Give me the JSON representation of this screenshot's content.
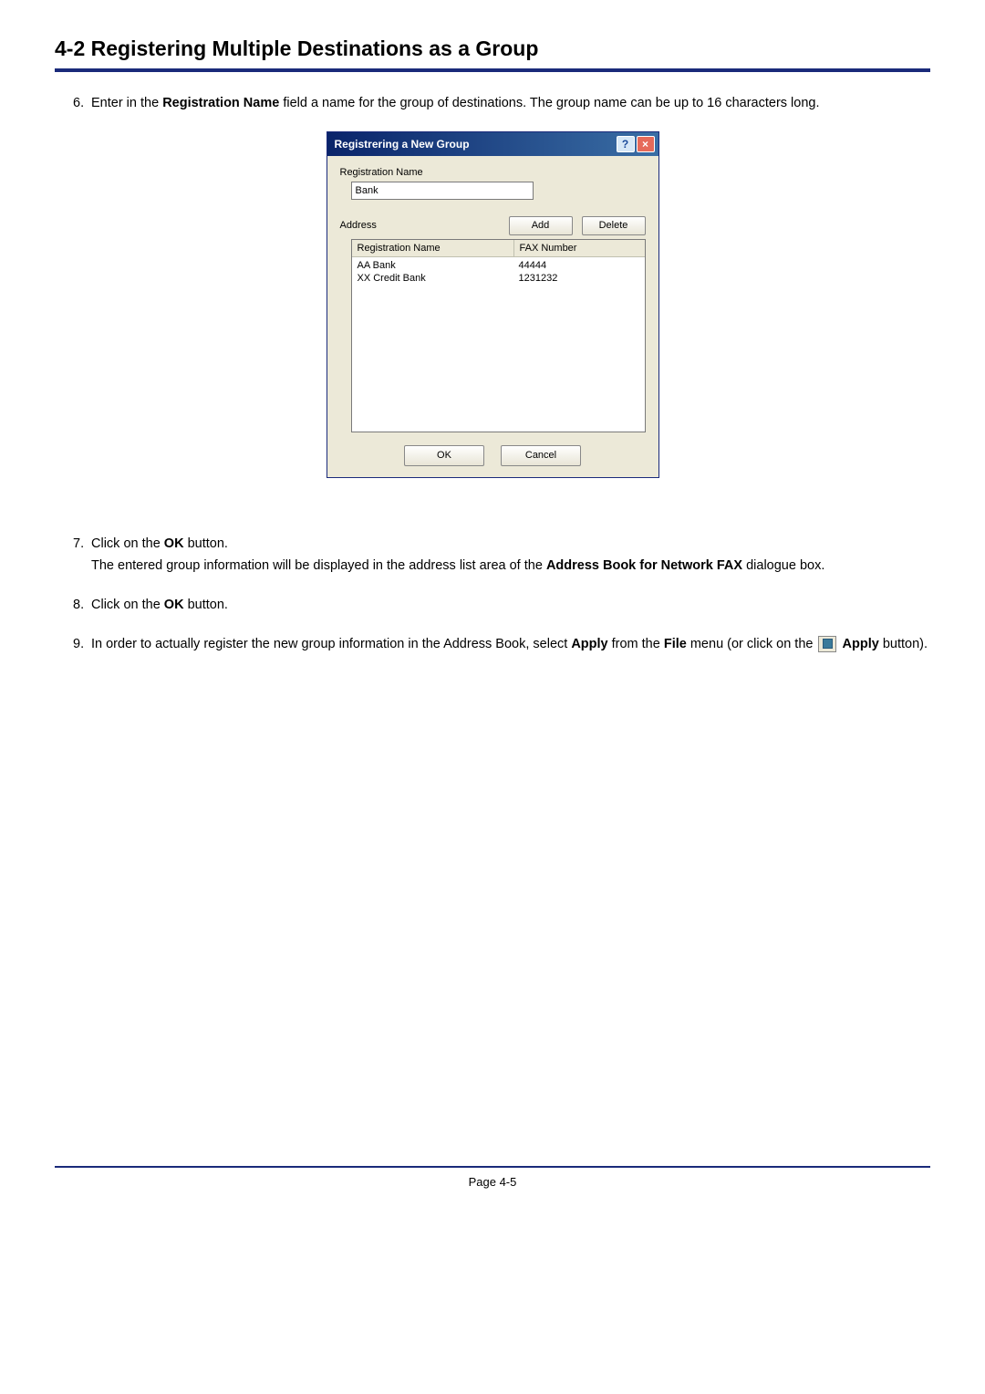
{
  "header": {
    "title": "4-2  Registering Multiple Destinations as a Group"
  },
  "steps": {
    "s6": {
      "num": "6.",
      "t1": "Enter in the ",
      "b1": "Registration Name",
      "t2": " field a name for the group of destinations. The group name can be up to 16 characters long."
    },
    "s7": {
      "num": "7.",
      "t1": "Click on the ",
      "b1": "OK",
      "t2": " button.",
      "t3": "The entered group information will be displayed in the address list area of the ",
      "b2": "Address Book for Network FAX",
      "t4": " dialogue box."
    },
    "s8": {
      "num": "8.",
      "t1": "Click on the ",
      "b1": "OK",
      "t2": " button."
    },
    "s9": {
      "num": "9.",
      "t1": "In order to actually register the new group information in the Address Book, select ",
      "b1": "Apply",
      "t2": " from the ",
      "b2": "File",
      "t3": " menu (or click on the ",
      "b3": "Apply",
      "t4": " button)."
    }
  },
  "dialog": {
    "title": "Registrering a New Group",
    "reg_name_label": "Registration Name",
    "reg_name_value": "Bank",
    "address_label": "Address",
    "add_btn": "Add",
    "delete_btn": "Delete",
    "col_reg": "Registration Name",
    "col_fax": "FAX Number",
    "rows": [
      {
        "name": "AA Bank",
        "fax": "44444"
      },
      {
        "name": "XX Credit Bank",
        "fax": "1231232"
      }
    ],
    "ok_btn": "OK",
    "cancel_btn": "Cancel"
  },
  "footer": {
    "page": "Page 4-5"
  }
}
